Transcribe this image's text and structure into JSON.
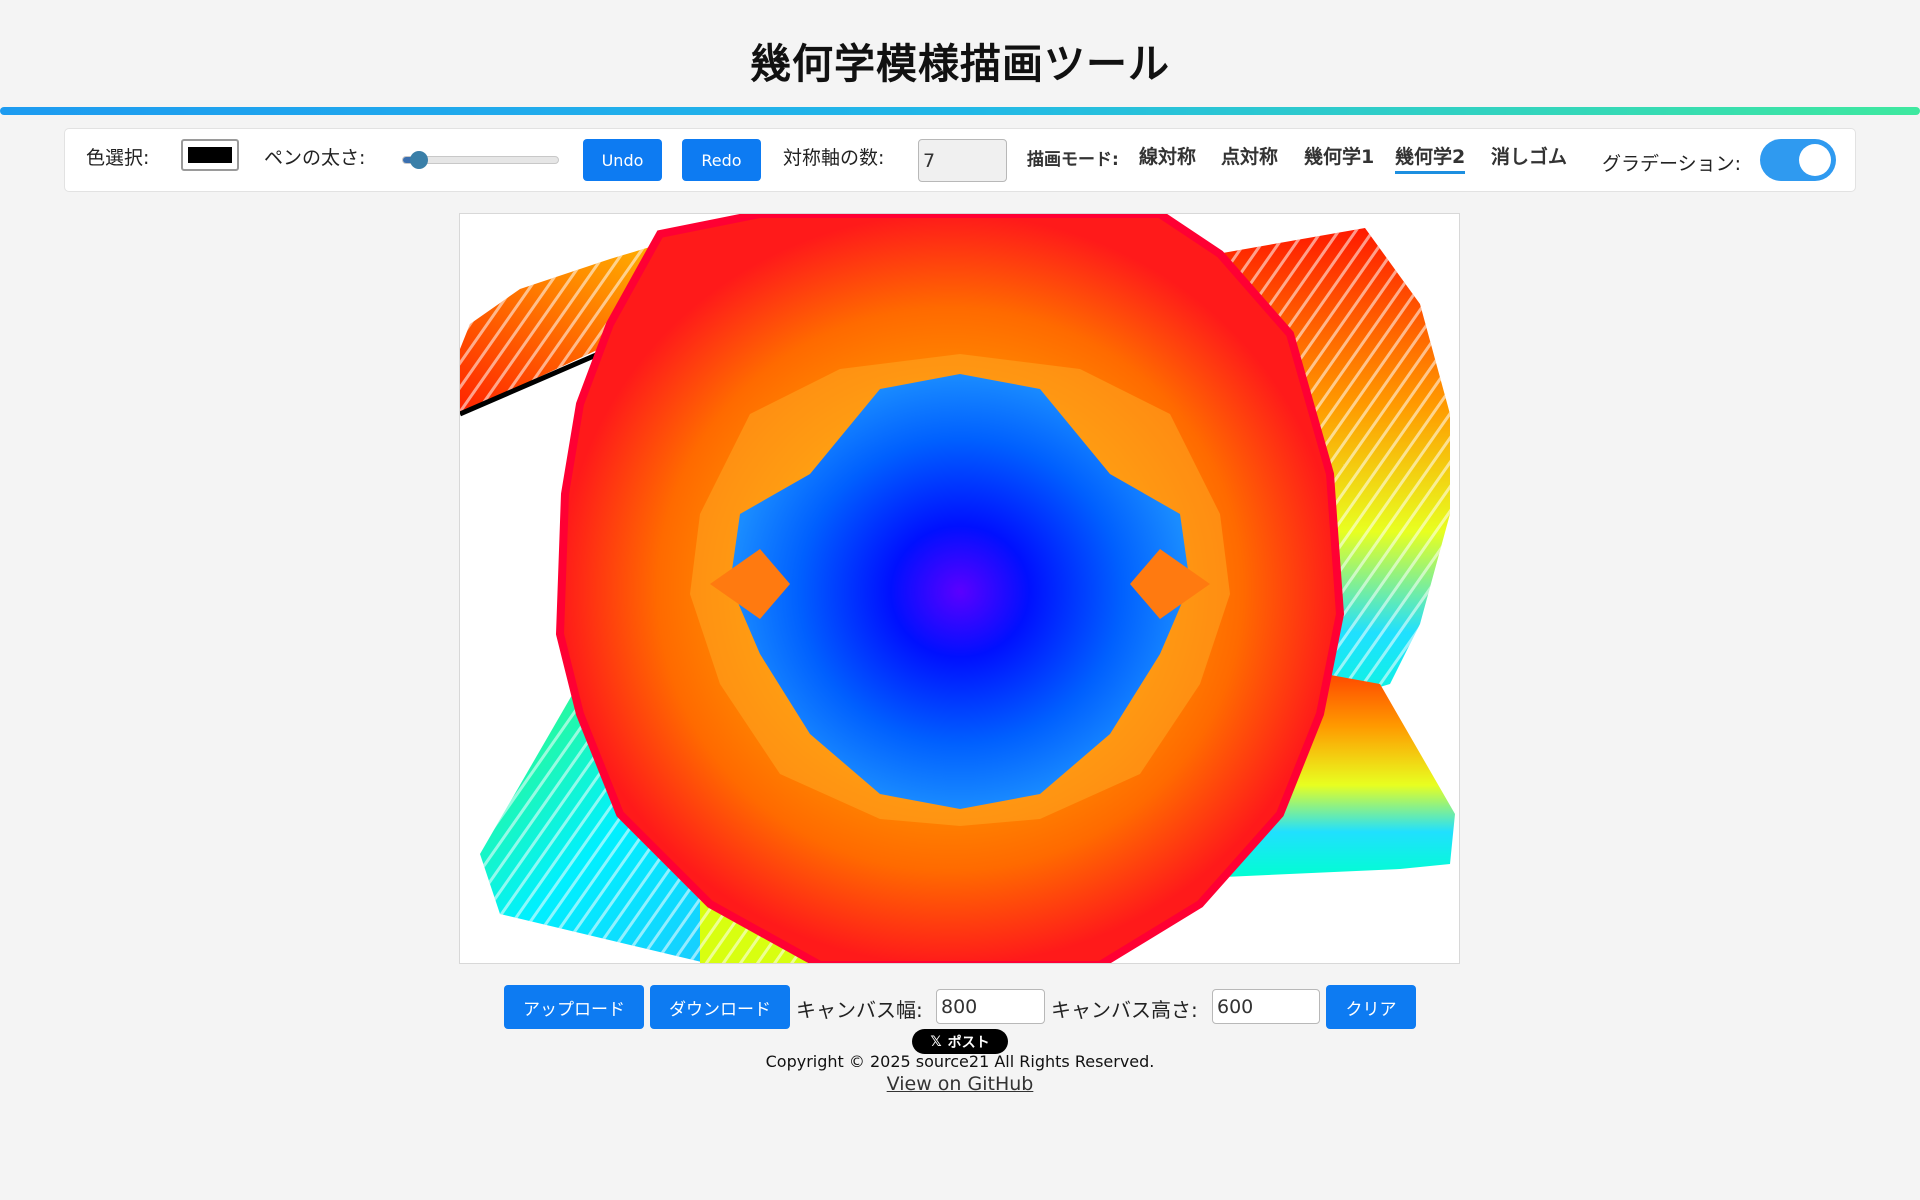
{
  "title": "幾何学模様描画ツール",
  "toolbar": {
    "color_label": "色選択:",
    "color_value": "#000000",
    "pen_label": "ペンの太さ:",
    "pen_level": 0.1,
    "undo_label": "Undo",
    "redo_label": "Redo",
    "axes_label": "対称軸の数:",
    "axes_value": "7",
    "mode_label": "描画モード:",
    "modes": [
      "線対称",
      "点対称",
      "幾何学1",
      "幾何学2",
      "消しゴム"
    ],
    "active_mode": "幾何学2",
    "gradient_label": "グラデーション:",
    "gradient_on": true
  },
  "bottom": {
    "upload_label": "アップロード",
    "download_label": "ダウンロード",
    "width_label": "キャンバス幅:",
    "width_value": "800",
    "height_label": "キャンバス高さ:",
    "height_value": "600",
    "clear_label": "クリア"
  },
  "footer": {
    "post_label": "ポスト",
    "copyright": "Copyright © 2025 source21 All Rights Reserved.",
    "github_link": "View on GitHub"
  },
  "colors": {
    "accent": "#0d7bf2",
    "toggle": "#2f9af0",
    "background": "#f4f4f4"
  }
}
